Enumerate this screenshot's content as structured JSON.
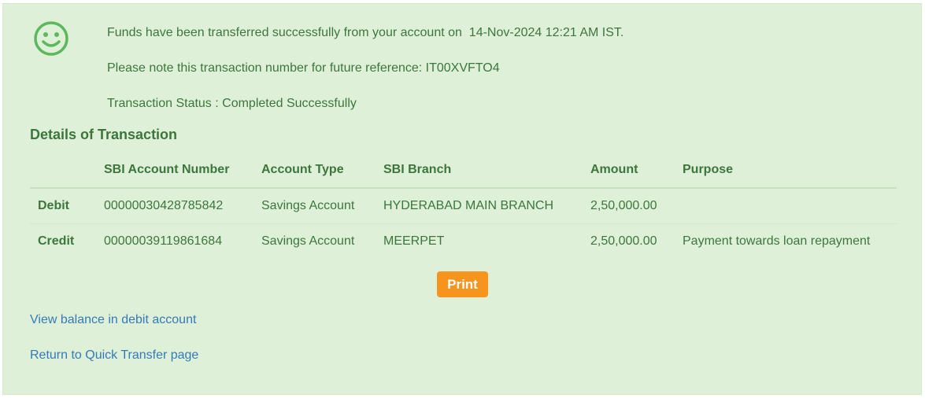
{
  "message": {
    "line1": "Funds have been transferred successfully from your account on  14-Nov-2024 12:21 AM IST.",
    "line2": "Please note this transaction number for future reference: IT00XVFTO4",
    "line3": "Transaction Status : Completed Successfully",
    "icon": "smiley-icon"
  },
  "details": {
    "title": "Details of Transaction",
    "columns": [
      "",
      "SBI Account Number",
      "Account Type",
      "SBI Branch",
      "Amount",
      "Purpose"
    ],
    "rows": [
      {
        "label": "Debit",
        "account_number": "00000030428785842",
        "account_type": "Savings Account",
        "branch": "HYDERABAD MAIN BRANCH",
        "amount": "2,50,000.00",
        "purpose": ""
      },
      {
        "label": "Credit",
        "account_number": "00000039119861684",
        "account_type": "Savings Account",
        "branch": "MEERPET",
        "amount": "2,50,000.00",
        "purpose": "Payment towards loan repayment"
      }
    ]
  },
  "actions": {
    "print_label": "Print",
    "view_balance_label": "View balance in debit account",
    "return_label": "Return to Quick Transfer page"
  },
  "colors": {
    "panel_bg": "#dff0d8",
    "text": "#3c763d",
    "icon": "#5cb85c",
    "print_button": "#f7941d",
    "link": "#337ab7"
  }
}
